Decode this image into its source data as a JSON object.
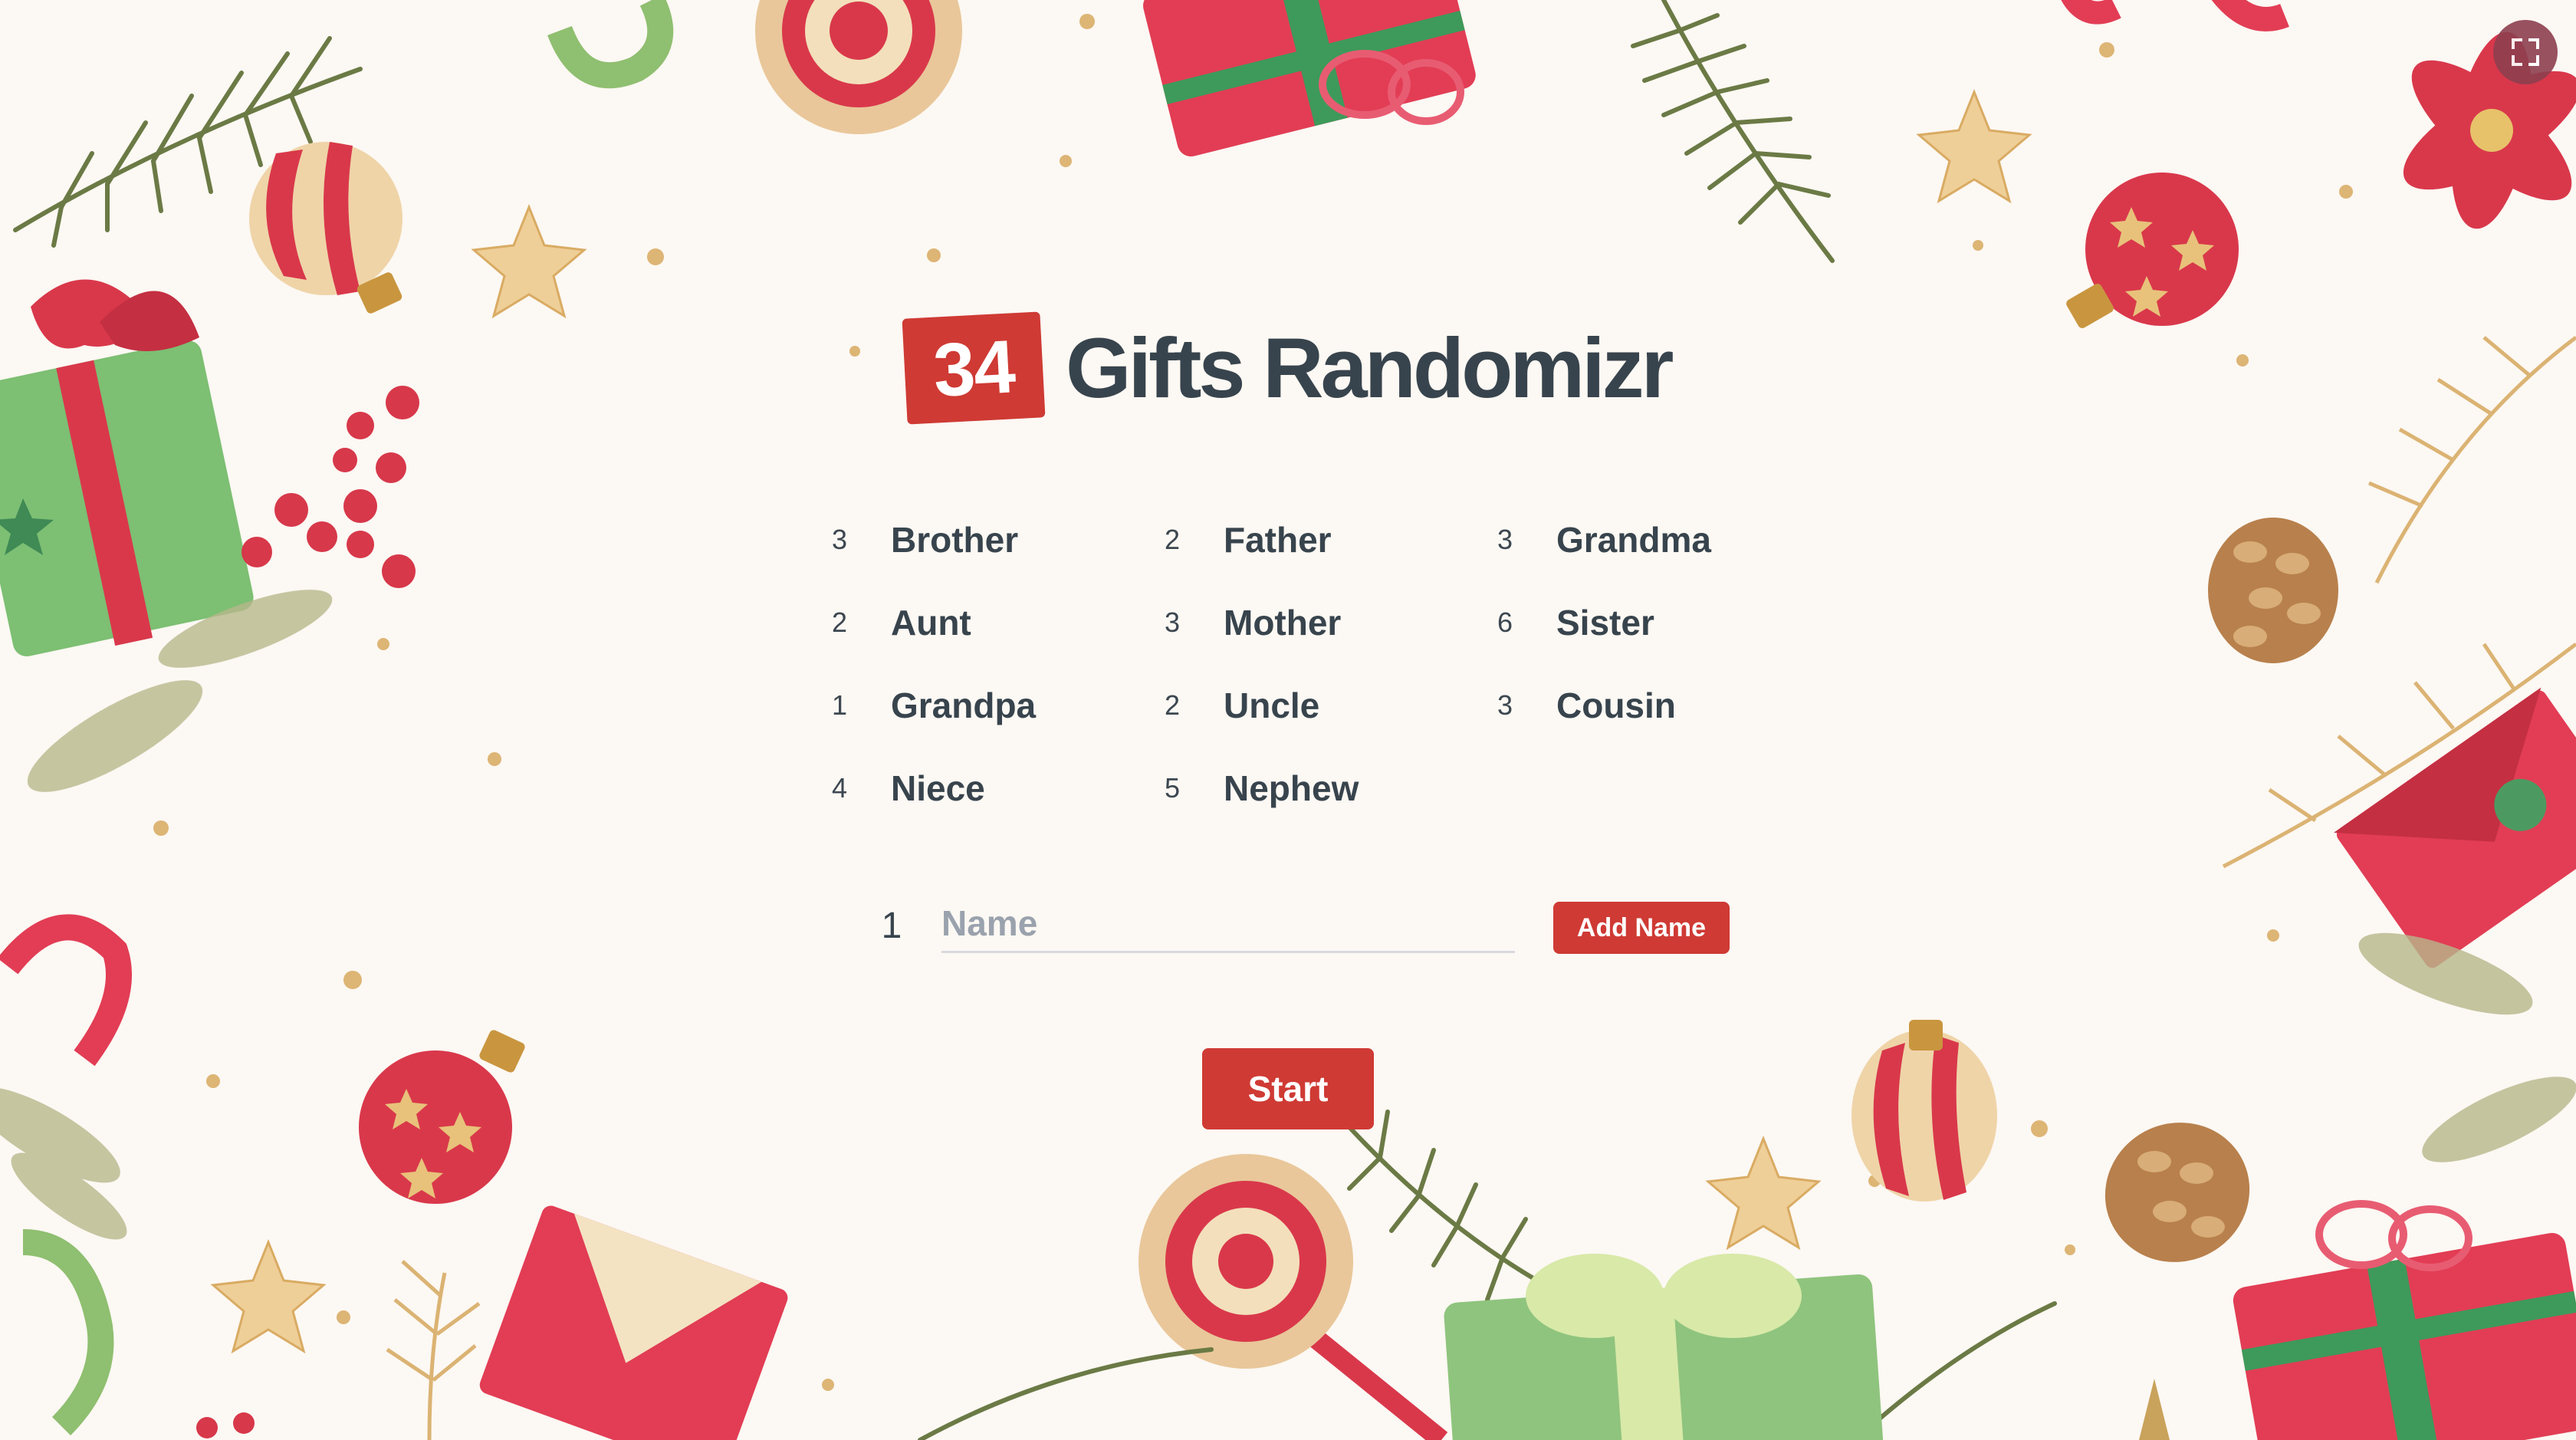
{
  "app": {
    "title": "Gifts Randomizr",
    "total_count": "34"
  },
  "names": [
    {
      "count": "3",
      "label": "Brother"
    },
    {
      "count": "2",
      "label": "Father"
    },
    {
      "count": "3",
      "label": "Grandma"
    },
    {
      "count": "2",
      "label": "Aunt"
    },
    {
      "count": "3",
      "label": "Mother"
    },
    {
      "count": "6",
      "label": "Sister"
    },
    {
      "count": "1",
      "label": "Grandpa"
    },
    {
      "count": "2",
      "label": "Uncle"
    },
    {
      "count": "3",
      "label": "Cousin"
    },
    {
      "count": "4",
      "label": "Niece"
    },
    {
      "count": "5",
      "label": "Nephew"
    }
  ],
  "add_form": {
    "next_number": "1",
    "input_value": "",
    "input_placeholder": "Name",
    "add_button_label": "Add Name"
  },
  "start_button_label": "Start",
  "icons": {
    "fullscreen": "fullscreen-icon"
  },
  "colors": {
    "accent": "#cf3a34",
    "text": "#38444d",
    "background": "#fcf8f3"
  }
}
